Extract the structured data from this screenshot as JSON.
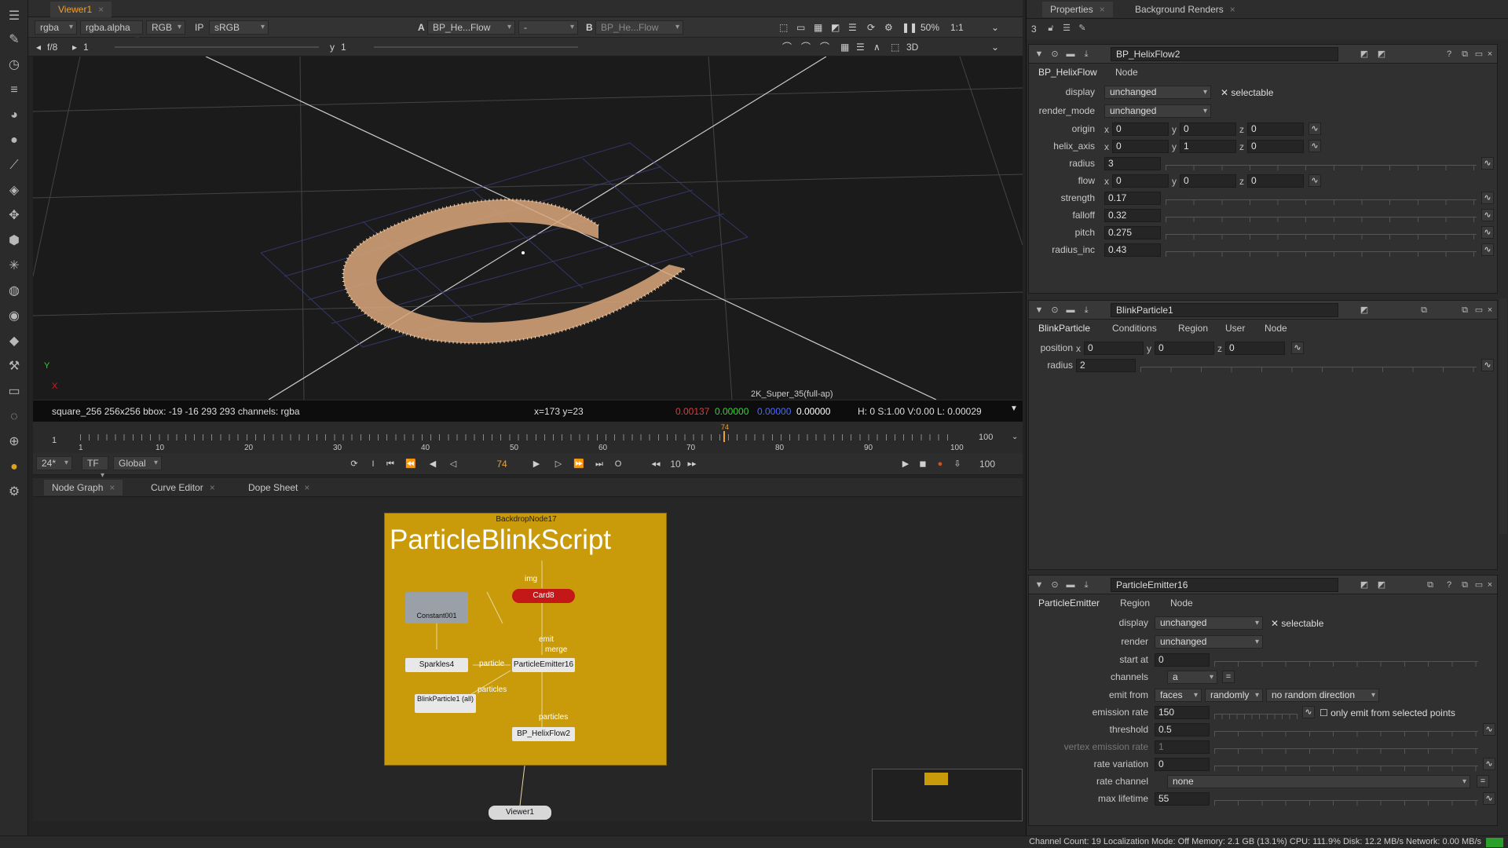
{
  "viewer_tab": {
    "label": "Viewer1",
    "close": "×"
  },
  "viewer_controls": {
    "channels": "rgba",
    "alpha": "rgba.alpha",
    "colorspace": "RGB",
    "ip": "IP",
    "lut": "sRGB",
    "input_a_letter": "A",
    "input_a": "BP_He...Flow",
    "dash": "-",
    "input_b_letter": "B",
    "input_b": "BP_He...Flow",
    "zoom": "50%",
    "ratio": "1:1",
    "fstop": "f/8",
    "frame_field": "1",
    "y_label": "y",
    "y_value": "1",
    "view_mode": "3D"
  },
  "viewport": {
    "format_label": "2K_Super_35(full-ap)",
    "axis_y": "Y",
    "axis_x": "X"
  },
  "info_bar": {
    "format": "square_256 256x256  bbox: -19 -16 293 293 channels: rgba",
    "coords": "x=173 y=23",
    "r": "0.00137",
    "g": "0.00000",
    "b": "0.00000",
    "a": "0.00000",
    "hsvl": "H:  0 S:1.00 V:0.00  L: 0.00029"
  },
  "timeline": {
    "start": "1",
    "end": "100",
    "ticks": [
      "1",
      "10",
      "20",
      "30",
      "40",
      "50",
      "60",
      "70",
      "80",
      "90",
      "100"
    ],
    "current_marker": "74"
  },
  "playback": {
    "fps": "24*",
    "tf": "TF",
    "scope": "Global",
    "current_frame": "74",
    "step": "10",
    "end_frame": "100",
    "buttons": [
      "⟳",
      "I",
      "⏮",
      "⏪",
      "◀",
      "◁",
      "▶",
      "▷",
      "⏩",
      "⏭",
      "O",
      "◂◂",
      "▸▸"
    ]
  },
  "nodegraph_tabs": [
    {
      "label": "Node Graph",
      "close": "×"
    },
    {
      "label": "Curve Editor",
      "close": "×"
    },
    {
      "label": "Dope Sheet",
      "close": "×"
    }
  ],
  "nodegraph": {
    "backdrop_name": "BackdropNode17",
    "backdrop_title": "ParticleBlinkScript",
    "nodes": {
      "card": "Card8",
      "constant": "Constant001",
      "sparkles": "Sparkles4",
      "emitter": "ParticleEmitter16",
      "blink": "BlinkParticle1 (all)",
      "helix": "BP_HelixFlow2",
      "viewer": "Viewer1"
    },
    "pipe_labels": {
      "img": "img",
      "emit": "emit",
      "merge": "merge",
      "particle": "particle",
      "particles1": "particles",
      "particles2": "particles"
    }
  },
  "properties": {
    "tabs": [
      {
        "label": "Properties",
        "close": "×"
      },
      {
        "label": "Background Renders",
        "close": "×"
      }
    ],
    "max_panels": "3",
    "helix": {
      "name": "BP_HelixFlow2",
      "tabs": [
        "BP_HelixFlow",
        "Node"
      ],
      "display_label": "display",
      "display": "unchanged",
      "selectable": "selectable",
      "render_mode_label": "render_mode",
      "render_mode": "unchanged",
      "origin_label": "origin",
      "origin": {
        "x": "0",
        "y": "0",
        "z": "0"
      },
      "helix_axis_label": "helix_axis",
      "helix_axis": {
        "x": "0",
        "y": "1",
        "z": "0"
      },
      "radius_label": "radius",
      "radius": "3",
      "flow_label": "flow",
      "flow": {
        "x": "0",
        "y": "0",
        "z": "0"
      },
      "strength_label": "strength",
      "strength": "0.17",
      "falloff_label": "falloff",
      "falloff": "0.32",
      "pitch_label": "pitch",
      "pitch": "0.275",
      "radius_inc_label": "radius_inc",
      "radius_inc": "0.43"
    },
    "blink": {
      "name": "BlinkParticle1",
      "tabs": [
        "BlinkParticle",
        "Conditions",
        "Region",
        "User",
        "Node"
      ],
      "position_label": "position",
      "position": {
        "x": "0",
        "y": "0",
        "z": "0"
      },
      "radius_label": "radius",
      "radius": "2"
    },
    "emitter": {
      "name": "ParticleEmitter16",
      "tabs": [
        "ParticleEmitter",
        "Region",
        "Node"
      ],
      "display_label": "display",
      "display": "unchanged",
      "selectable": "selectable",
      "render_label": "render",
      "render": "unchanged",
      "start_at_label": "start at",
      "start_at": "0",
      "channels_label": "channels",
      "channels": "a",
      "emit_from_label": "emit from",
      "emit_from": "faces",
      "emit_order": "randomly",
      "direction": "no random direction",
      "emission_rate_label": "emission rate",
      "emission_rate": "150",
      "only_emit": "only emit from selected points",
      "threshold_label": "threshold",
      "threshold": "0.5",
      "vertex_rate_label": "vertex emission rate",
      "vertex_rate": "1",
      "rate_variation_label": "rate variation",
      "rate_variation": "0",
      "rate_channel_label": "rate channel",
      "rate_channel": "none",
      "max_lifetime_label": "max lifetime",
      "max_lifetime": "55"
    }
  },
  "statusbar": {
    "text": "Channel Count: 19  Localization Mode: Off  Memory: 2.1 GB (13.1%)  CPU: 111.9%  Disk: 12.2 MB/s  Network: 0.00 MB/s"
  },
  "colors": {
    "accent": "#f0a030",
    "backdrop": "#c99a09",
    "card_node": "#c41818"
  }
}
